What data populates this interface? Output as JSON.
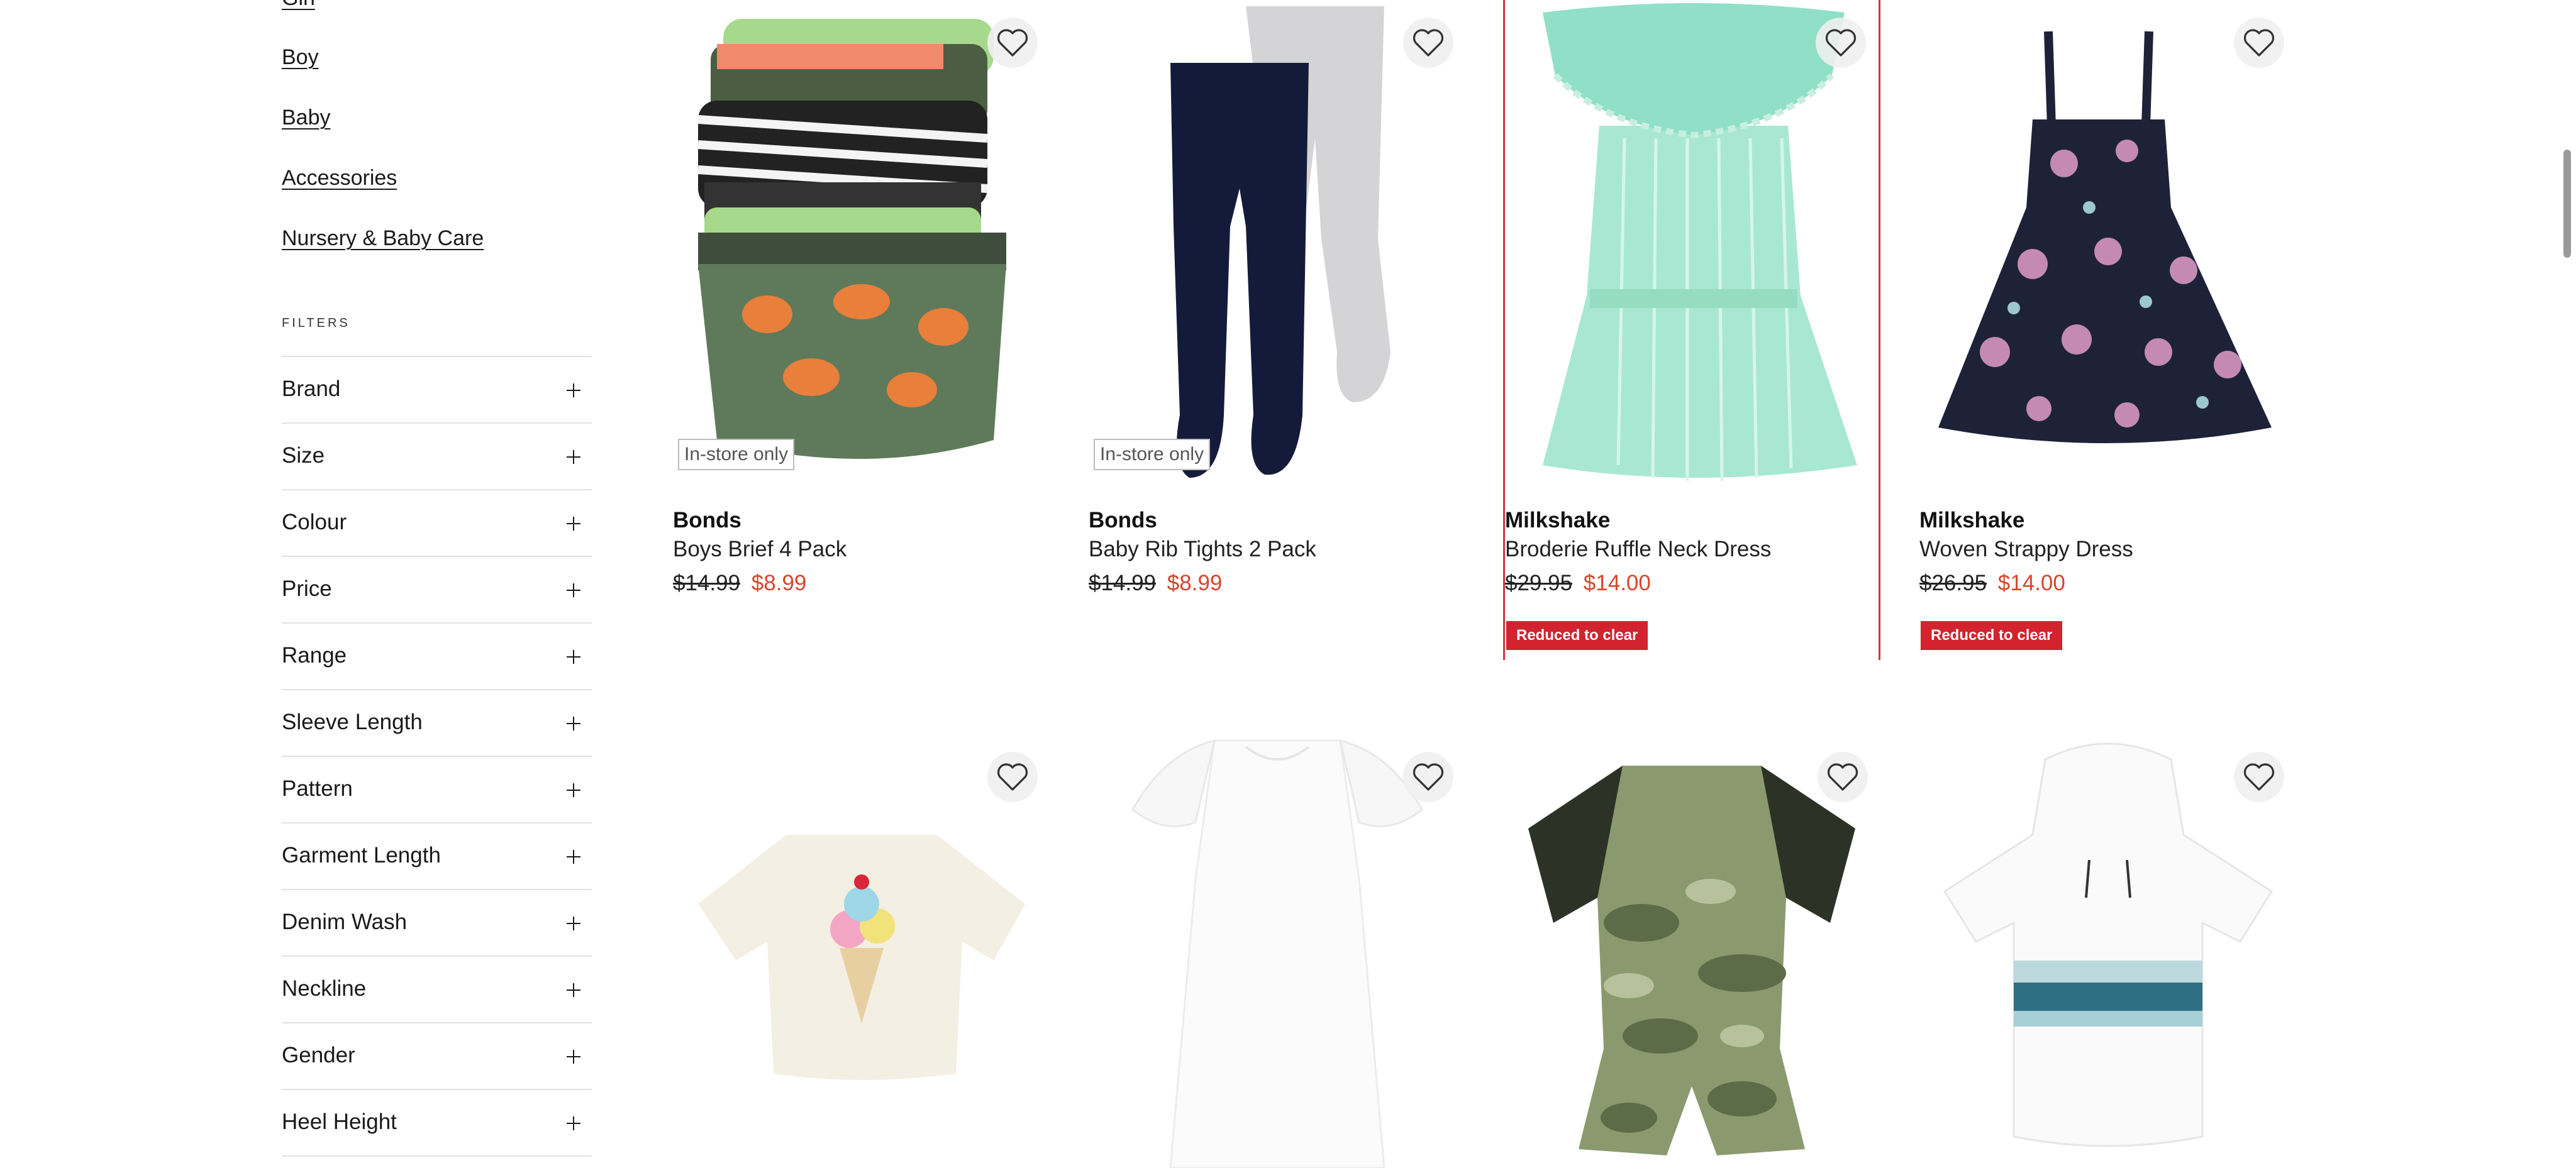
{
  "categories": [
    {
      "label": "Girl"
    },
    {
      "label": "Boy"
    },
    {
      "label": "Baby"
    },
    {
      "label": "Accessories"
    },
    {
      "label": "Nursery & Baby Care"
    }
  ],
  "filters": {
    "heading": "FILTERS",
    "items": [
      {
        "label": "Brand"
      },
      {
        "label": "Size"
      },
      {
        "label": "Colour"
      },
      {
        "label": "Price"
      },
      {
        "label": "Range"
      },
      {
        "label": "Sleeve Length"
      },
      {
        "label": "Pattern"
      },
      {
        "label": "Garment Length"
      },
      {
        "label": "Denim Wash"
      },
      {
        "label": "Neckline"
      },
      {
        "label": "Gender"
      },
      {
        "label": "Heel Height"
      }
    ]
  },
  "products": [
    {
      "brand": "Bonds",
      "name": "Boys Brief 4 Pack",
      "price_was": "$14.99",
      "price_now": "$8.99",
      "availability": "In-store only",
      "badge": ""
    },
    {
      "brand": "Bonds",
      "name": "Baby Rib Tights 2 Pack",
      "price_was": "$14.99",
      "price_now": "$8.99",
      "availability": "In-store only",
      "badge": ""
    },
    {
      "brand": "Milkshake",
      "name": "Broderie Ruffle Neck Dress",
      "price_was": "$29.95",
      "price_now": "$14.00",
      "availability": "",
      "badge": "Reduced to clear"
    },
    {
      "brand": "Milkshake",
      "name": "Woven Strappy Dress",
      "price_was": "$26.95",
      "price_now": "$14.00",
      "availability": "",
      "badge": "Reduced to clear"
    },
    {
      "brand": "",
      "name": "",
      "price_was": "",
      "price_now": ""
    },
    {
      "brand": "",
      "name": "",
      "price_was": "",
      "price_now": ""
    },
    {
      "brand": "",
      "name": "",
      "price_was": "",
      "price_now": ""
    },
    {
      "brand": "",
      "name": "",
      "price_was": "",
      "price_now": ""
    }
  ],
  "icons": {
    "wishlist": "heart-outline-icon",
    "filter_toggle": "plus-icon"
  },
  "colors": {
    "sale_price": "#d9452b",
    "badge_bg": "#d2232f",
    "selection_outline": "#d4333f"
  }
}
